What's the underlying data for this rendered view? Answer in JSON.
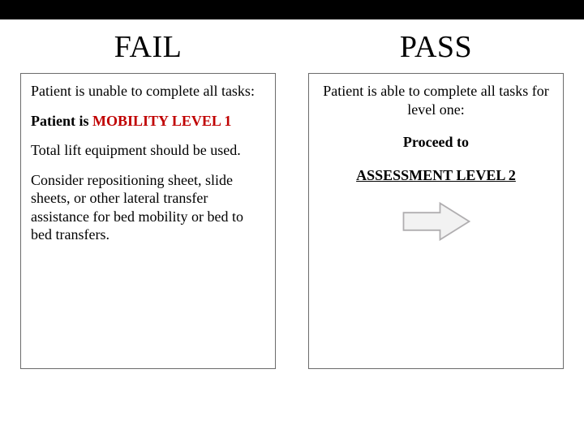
{
  "fail": {
    "heading": "FAIL",
    "line1": "Patient is unable to complete all tasks:",
    "line2_prefix": "Patient is ",
    "line2_em": "MOBILITY LEVEL 1",
    "line3": "Total lift equipment should be used.",
    "line4": "Consider repositioning sheet, slide sheets, or other lateral transfer assistance for bed mobility or bed to bed transfers."
  },
  "pass": {
    "heading": "PASS",
    "line1": "Patient is able to complete all tasks for level one:",
    "line2": "Proceed to",
    "line3": "ASSESSMENT LEVEL 2"
  }
}
